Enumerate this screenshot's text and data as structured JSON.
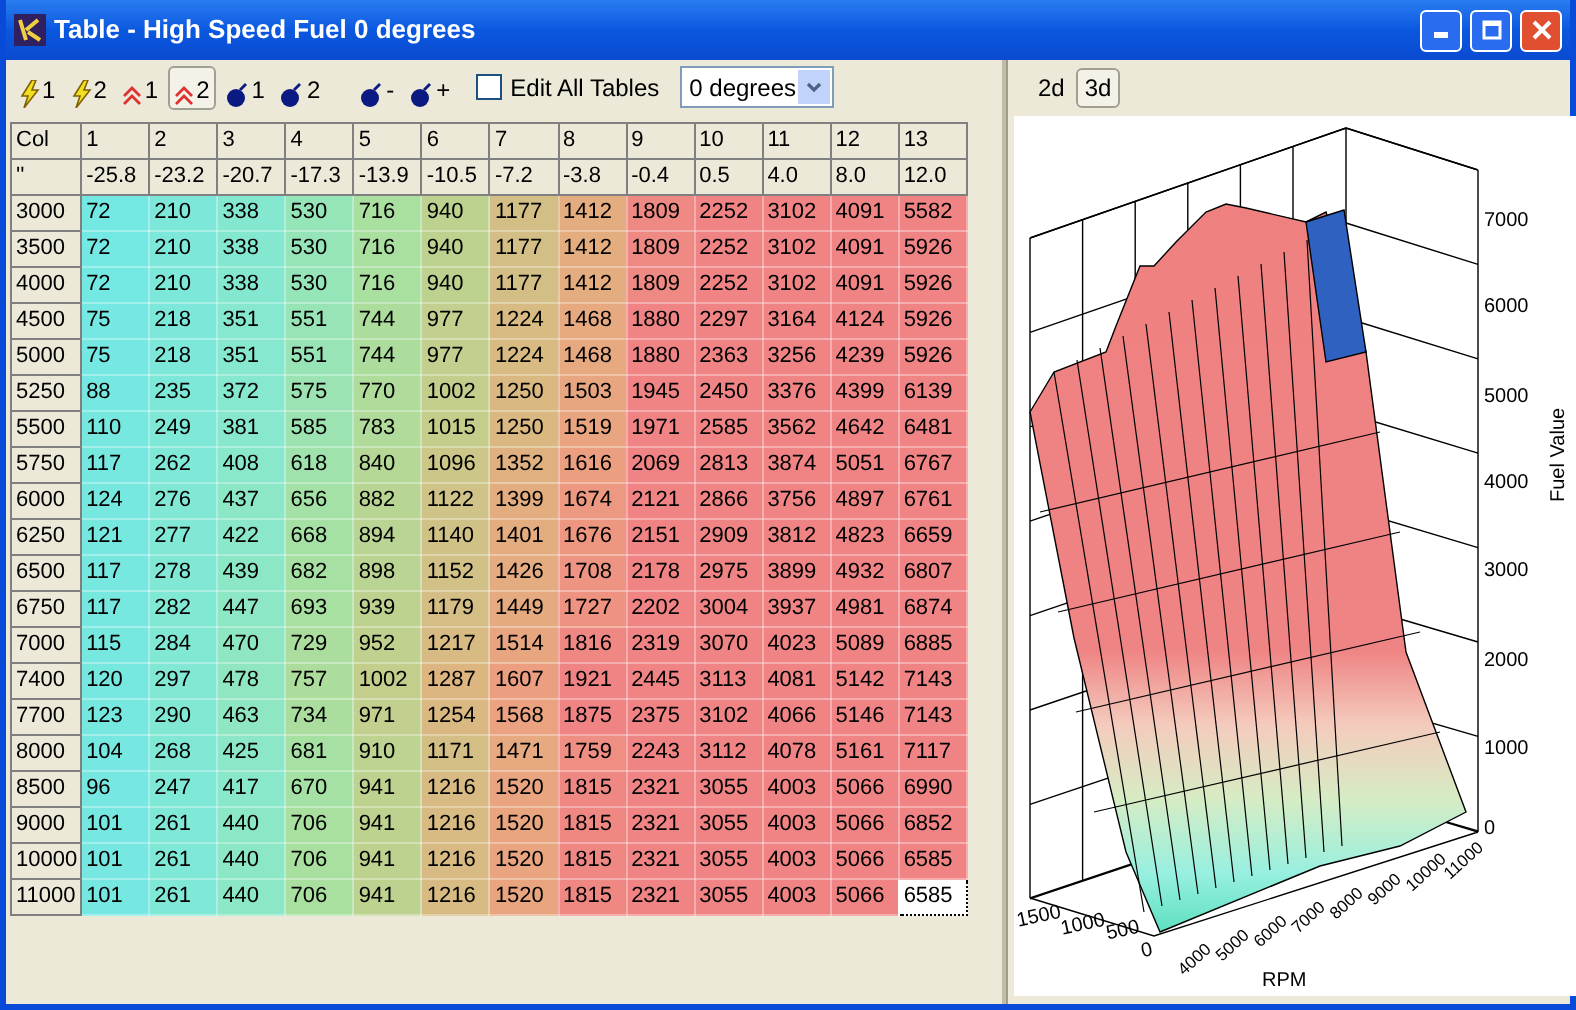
{
  "window": {
    "title": "Table - High Speed Fuel 0 degrees"
  },
  "toolbar": [
    {
      "kind": "lightning",
      "label": "1",
      "selected": false
    },
    {
      "kind": "lightning",
      "label": "2",
      "selected": false
    },
    {
      "kind": "chevrons",
      "label": "1",
      "selected": false
    },
    {
      "kind": "chevrons",
      "label": "2",
      "selected": true
    },
    {
      "kind": "bomb",
      "label": "1",
      "selected": false
    },
    {
      "kind": "bomb",
      "label": "2",
      "selected": false
    },
    {
      "kind": "bomb",
      "label": "-",
      "selected": false
    },
    {
      "kind": "bomb",
      "label": "+",
      "selected": false
    }
  ],
  "edit_all_tables": {
    "label": "Edit All Tables",
    "checked": false
  },
  "degrees_select": {
    "value": "0 degrees"
  },
  "table": {
    "corner": "Col",
    "columns": [
      "1",
      "2",
      "3",
      "4",
      "5",
      "6",
      "7",
      "8",
      "9",
      "10",
      "11",
      "12",
      "13"
    ],
    "row2_label": "''",
    "row2": [
      "-25.8",
      "-23.2",
      "-20.7",
      "-17.3",
      "-13.9",
      "-10.5",
      "-7.2",
      "-3.8",
      "-0.4",
      "0.5",
      "4.0",
      "8.0",
      "12.0"
    ],
    "rows": [
      {
        "rpm": "3000",
        "cells": [
          {
            "value": "72",
            "selected": false
          },
          {
            "value": "210",
            "selected": false
          },
          {
            "value": "338",
            "selected": false
          },
          {
            "value": "530",
            "selected": false
          },
          {
            "value": "716",
            "selected": false
          },
          {
            "value": "940",
            "selected": false
          },
          {
            "value": "1177",
            "selected": false
          },
          {
            "value": "1412",
            "selected": false
          },
          {
            "value": "1809",
            "selected": false
          },
          {
            "value": "2252",
            "selected": false
          },
          {
            "value": "3102",
            "selected": false
          },
          {
            "value": "4091",
            "selected": false
          },
          {
            "value": "5582",
            "selected": false
          }
        ]
      },
      {
        "rpm": "3500",
        "cells": [
          {
            "value": "72",
            "selected": false
          },
          {
            "value": "210",
            "selected": false
          },
          {
            "value": "338",
            "selected": false
          },
          {
            "value": "530",
            "selected": false
          },
          {
            "value": "716",
            "selected": false
          },
          {
            "value": "940",
            "selected": false
          },
          {
            "value": "1177",
            "selected": false
          },
          {
            "value": "1412",
            "selected": false
          },
          {
            "value": "1809",
            "selected": false
          },
          {
            "value": "2252",
            "selected": false
          },
          {
            "value": "3102",
            "selected": false
          },
          {
            "value": "4091",
            "selected": false
          },
          {
            "value": "5926",
            "selected": false
          }
        ]
      },
      {
        "rpm": "4000",
        "cells": [
          {
            "value": "72",
            "selected": false
          },
          {
            "value": "210",
            "selected": false
          },
          {
            "value": "338",
            "selected": false
          },
          {
            "value": "530",
            "selected": false
          },
          {
            "value": "716",
            "selected": false
          },
          {
            "value": "940",
            "selected": false
          },
          {
            "value": "1177",
            "selected": false
          },
          {
            "value": "1412",
            "selected": false
          },
          {
            "value": "1809",
            "selected": false
          },
          {
            "value": "2252",
            "selected": false
          },
          {
            "value": "3102",
            "selected": false
          },
          {
            "value": "4091",
            "selected": false
          },
          {
            "value": "5926",
            "selected": false
          }
        ]
      },
      {
        "rpm": "4500",
        "cells": [
          {
            "value": "75",
            "selected": false
          },
          {
            "value": "218",
            "selected": false
          },
          {
            "value": "351",
            "selected": false
          },
          {
            "value": "551",
            "selected": false
          },
          {
            "value": "744",
            "selected": false
          },
          {
            "value": "977",
            "selected": false
          },
          {
            "value": "1224",
            "selected": false
          },
          {
            "value": "1468",
            "selected": false
          },
          {
            "value": "1880",
            "selected": false
          },
          {
            "value": "2297",
            "selected": false
          },
          {
            "value": "3164",
            "selected": false
          },
          {
            "value": "4124",
            "selected": false
          },
          {
            "value": "5926",
            "selected": false
          }
        ]
      },
      {
        "rpm": "5000",
        "cells": [
          {
            "value": "75",
            "selected": false
          },
          {
            "value": "218",
            "selected": false
          },
          {
            "value": "351",
            "selected": false
          },
          {
            "value": "551",
            "selected": false
          },
          {
            "value": "744",
            "selected": false
          },
          {
            "value": "977",
            "selected": false
          },
          {
            "value": "1224",
            "selected": false
          },
          {
            "value": "1468",
            "selected": false
          },
          {
            "value": "1880",
            "selected": false
          },
          {
            "value": "2363",
            "selected": false
          },
          {
            "value": "3256",
            "selected": false
          },
          {
            "value": "4239",
            "selected": false
          },
          {
            "value": "5926",
            "selected": false
          }
        ]
      },
      {
        "rpm": "5250",
        "cells": [
          {
            "value": "88",
            "selected": false
          },
          {
            "value": "235",
            "selected": false
          },
          {
            "value": "372",
            "selected": false
          },
          {
            "value": "575",
            "selected": false
          },
          {
            "value": "770",
            "selected": false
          },
          {
            "value": "1002",
            "selected": false
          },
          {
            "value": "1250",
            "selected": false
          },
          {
            "value": "1503",
            "selected": false
          },
          {
            "value": "1945",
            "selected": false
          },
          {
            "value": "2450",
            "selected": false
          },
          {
            "value": "3376",
            "selected": false
          },
          {
            "value": "4399",
            "selected": false
          },
          {
            "value": "6139",
            "selected": false
          }
        ]
      },
      {
        "rpm": "5500",
        "cells": [
          {
            "value": "110",
            "selected": false
          },
          {
            "value": "249",
            "selected": false
          },
          {
            "value": "381",
            "selected": false
          },
          {
            "value": "585",
            "selected": false
          },
          {
            "value": "783",
            "selected": false
          },
          {
            "value": "1015",
            "selected": false
          },
          {
            "value": "1250",
            "selected": false
          },
          {
            "value": "1519",
            "selected": false
          },
          {
            "value": "1971",
            "selected": false
          },
          {
            "value": "2585",
            "selected": false
          },
          {
            "value": "3562",
            "selected": false
          },
          {
            "value": "4642",
            "selected": false
          },
          {
            "value": "6481",
            "selected": false
          }
        ]
      },
      {
        "rpm": "5750",
        "cells": [
          {
            "value": "117",
            "selected": false
          },
          {
            "value": "262",
            "selected": false
          },
          {
            "value": "408",
            "selected": false
          },
          {
            "value": "618",
            "selected": false
          },
          {
            "value": "840",
            "selected": false
          },
          {
            "value": "1096",
            "selected": false
          },
          {
            "value": "1352",
            "selected": false
          },
          {
            "value": "1616",
            "selected": false
          },
          {
            "value": "2069",
            "selected": false
          },
          {
            "value": "2813",
            "selected": false
          },
          {
            "value": "3874",
            "selected": false
          },
          {
            "value": "5051",
            "selected": false
          },
          {
            "value": "6767",
            "selected": false
          }
        ]
      },
      {
        "rpm": "6000",
        "cells": [
          {
            "value": "124",
            "selected": false
          },
          {
            "value": "276",
            "selected": false
          },
          {
            "value": "437",
            "selected": false
          },
          {
            "value": "656",
            "selected": false
          },
          {
            "value": "882",
            "selected": false
          },
          {
            "value": "1122",
            "selected": false
          },
          {
            "value": "1399",
            "selected": false
          },
          {
            "value": "1674",
            "selected": false
          },
          {
            "value": "2121",
            "selected": false
          },
          {
            "value": "2866",
            "selected": false
          },
          {
            "value": "3756",
            "selected": false
          },
          {
            "value": "4897",
            "selected": false
          },
          {
            "value": "6761",
            "selected": false
          }
        ]
      },
      {
        "rpm": "6250",
        "cells": [
          {
            "value": "121",
            "selected": false
          },
          {
            "value": "277",
            "selected": false
          },
          {
            "value": "422",
            "selected": false
          },
          {
            "value": "668",
            "selected": false
          },
          {
            "value": "894",
            "selected": false
          },
          {
            "value": "1140",
            "selected": false
          },
          {
            "value": "1401",
            "selected": false
          },
          {
            "value": "1676",
            "selected": false
          },
          {
            "value": "2151",
            "selected": false
          },
          {
            "value": "2909",
            "selected": false
          },
          {
            "value": "3812",
            "selected": false
          },
          {
            "value": "4823",
            "selected": false
          },
          {
            "value": "6659",
            "selected": false
          }
        ]
      },
      {
        "rpm": "6500",
        "cells": [
          {
            "value": "117",
            "selected": false
          },
          {
            "value": "278",
            "selected": false
          },
          {
            "value": "439",
            "selected": false
          },
          {
            "value": "682",
            "selected": false
          },
          {
            "value": "898",
            "selected": false
          },
          {
            "value": "1152",
            "selected": false
          },
          {
            "value": "1426",
            "selected": false
          },
          {
            "value": "1708",
            "selected": false
          },
          {
            "value": "2178",
            "selected": false
          },
          {
            "value": "2975",
            "selected": false
          },
          {
            "value": "3899",
            "selected": false
          },
          {
            "value": "4932",
            "selected": false
          },
          {
            "value": "6807",
            "selected": false
          }
        ]
      },
      {
        "rpm": "6750",
        "cells": [
          {
            "value": "117",
            "selected": false
          },
          {
            "value": "282",
            "selected": false
          },
          {
            "value": "447",
            "selected": false
          },
          {
            "value": "693",
            "selected": false
          },
          {
            "value": "939",
            "selected": false
          },
          {
            "value": "1179",
            "selected": false
          },
          {
            "value": "1449",
            "selected": false
          },
          {
            "value": "1727",
            "selected": false
          },
          {
            "value": "2202",
            "selected": false
          },
          {
            "value": "3004",
            "selected": false
          },
          {
            "value": "3937",
            "selected": false
          },
          {
            "value": "4981",
            "selected": false
          },
          {
            "value": "6874",
            "selected": false
          }
        ]
      },
      {
        "rpm": "7000",
        "cells": [
          {
            "value": "115",
            "selected": false
          },
          {
            "value": "284",
            "selected": false
          },
          {
            "value": "470",
            "selected": false
          },
          {
            "value": "729",
            "selected": false
          },
          {
            "value": "952",
            "selected": false
          },
          {
            "value": "1217",
            "selected": false
          },
          {
            "value": "1514",
            "selected": false
          },
          {
            "value": "1816",
            "selected": false
          },
          {
            "value": "2319",
            "selected": false
          },
          {
            "value": "3070",
            "selected": false
          },
          {
            "value": "4023",
            "selected": false
          },
          {
            "value": "5089",
            "selected": false
          },
          {
            "value": "6885",
            "selected": false
          }
        ]
      },
      {
        "rpm": "7400",
        "cells": [
          {
            "value": "120",
            "selected": false
          },
          {
            "value": "297",
            "selected": false
          },
          {
            "value": "478",
            "selected": false
          },
          {
            "value": "757",
            "selected": false
          },
          {
            "value": "1002",
            "selected": false
          },
          {
            "value": "1287",
            "selected": false
          },
          {
            "value": "1607",
            "selected": false
          },
          {
            "value": "1921",
            "selected": false
          },
          {
            "value": "2445",
            "selected": false
          },
          {
            "value": "3113",
            "selected": false
          },
          {
            "value": "4081",
            "selected": false
          },
          {
            "value": "5142",
            "selected": false
          },
          {
            "value": "7143",
            "selected": false
          }
        ]
      },
      {
        "rpm": "7700",
        "cells": [
          {
            "value": "123",
            "selected": false
          },
          {
            "value": "290",
            "selected": false
          },
          {
            "value": "463",
            "selected": false
          },
          {
            "value": "734",
            "selected": false
          },
          {
            "value": "971",
            "selected": false
          },
          {
            "value": "1254",
            "selected": false
          },
          {
            "value": "1568",
            "selected": false
          },
          {
            "value": "1875",
            "selected": false
          },
          {
            "value": "2375",
            "selected": false
          },
          {
            "value": "3102",
            "selected": false
          },
          {
            "value": "4066",
            "selected": false
          },
          {
            "value": "5146",
            "selected": false
          },
          {
            "value": "7143",
            "selected": false
          }
        ]
      },
      {
        "rpm": "8000",
        "cells": [
          {
            "value": "104",
            "selected": false
          },
          {
            "value": "268",
            "selected": false
          },
          {
            "value": "425",
            "selected": false
          },
          {
            "value": "681",
            "selected": false
          },
          {
            "value": "910",
            "selected": false
          },
          {
            "value": "1171",
            "selected": false
          },
          {
            "value": "1471",
            "selected": false
          },
          {
            "value": "1759",
            "selected": false
          },
          {
            "value": "2243",
            "selected": false
          },
          {
            "value": "3112",
            "selected": false
          },
          {
            "value": "4078",
            "selected": false
          },
          {
            "value": "5161",
            "selected": false
          },
          {
            "value": "7117",
            "selected": false
          }
        ]
      },
      {
        "rpm": "8500",
        "cells": [
          {
            "value": "96",
            "selected": false
          },
          {
            "value": "247",
            "selected": false
          },
          {
            "value": "417",
            "selected": false
          },
          {
            "value": "670",
            "selected": false
          },
          {
            "value": "941",
            "selected": false
          },
          {
            "value": "1216",
            "selected": false
          },
          {
            "value": "1520",
            "selected": false
          },
          {
            "value": "1815",
            "selected": false
          },
          {
            "value": "2321",
            "selected": false
          },
          {
            "value": "3055",
            "selected": false
          },
          {
            "value": "4003",
            "selected": false
          },
          {
            "value": "5066",
            "selected": false
          },
          {
            "value": "6990",
            "selected": false
          }
        ]
      },
      {
        "rpm": "9000",
        "cells": [
          {
            "value": "101",
            "selected": false
          },
          {
            "value": "261",
            "selected": false
          },
          {
            "value": "440",
            "selected": false
          },
          {
            "value": "706",
            "selected": false
          },
          {
            "value": "941",
            "selected": false
          },
          {
            "value": "1216",
            "selected": false
          },
          {
            "value": "1520",
            "selected": false
          },
          {
            "value": "1815",
            "selected": false
          },
          {
            "value": "2321",
            "selected": false
          },
          {
            "value": "3055",
            "selected": false
          },
          {
            "value": "4003",
            "selected": false
          },
          {
            "value": "5066",
            "selected": false
          },
          {
            "value": "6852",
            "selected": false
          }
        ]
      },
      {
        "rpm": "10000",
        "cells": [
          {
            "value": "101",
            "selected": false
          },
          {
            "value": "261",
            "selected": false
          },
          {
            "value": "440",
            "selected": false
          },
          {
            "value": "706",
            "selected": false
          },
          {
            "value": "941",
            "selected": false
          },
          {
            "value": "1216",
            "selected": false
          },
          {
            "value": "1520",
            "selected": false
          },
          {
            "value": "1815",
            "selected": false
          },
          {
            "value": "2321",
            "selected": false
          },
          {
            "value": "3055",
            "selected": false
          },
          {
            "value": "4003",
            "selected": false
          },
          {
            "value": "5066",
            "selected": false
          },
          {
            "value": "6585",
            "selected": false
          }
        ]
      },
      {
        "rpm": "11000",
        "cells": [
          {
            "value": "101",
            "selected": false
          },
          {
            "value": "261",
            "selected": false
          },
          {
            "value": "440",
            "selected": false
          },
          {
            "value": "706",
            "selected": false
          },
          {
            "value": "941",
            "selected": false
          },
          {
            "value": "1216",
            "selected": false
          },
          {
            "value": "1520",
            "selected": false
          },
          {
            "value": "1815",
            "selected": false
          },
          {
            "value": "2321",
            "selected": false
          },
          {
            "value": "3055",
            "selected": false
          },
          {
            "value": "4003",
            "selected": false
          },
          {
            "value": "5066",
            "selected": false
          },
          {
            "value": "6585",
            "selected": true
          }
        ]
      }
    ]
  },
  "view_tabs": [
    {
      "label": "2d",
      "selected": false
    },
    {
      "label": "3d",
      "selected": true
    }
  ],
  "plot": {
    "z_label": "Fuel Value",
    "z_ticks": [
      "7000",
      "6000",
      "5000",
      "4000",
      "3000",
      "2000",
      "1000",
      "0"
    ],
    "x_label": "RPM",
    "x_ticks": [
      "4000",
      "5000",
      "6000",
      "7000",
      "8000",
      "9000",
      "10000",
      "11000"
    ],
    "y_ticks": [
      "1500",
      "1000",
      "500",
      "0"
    ]
  }
}
